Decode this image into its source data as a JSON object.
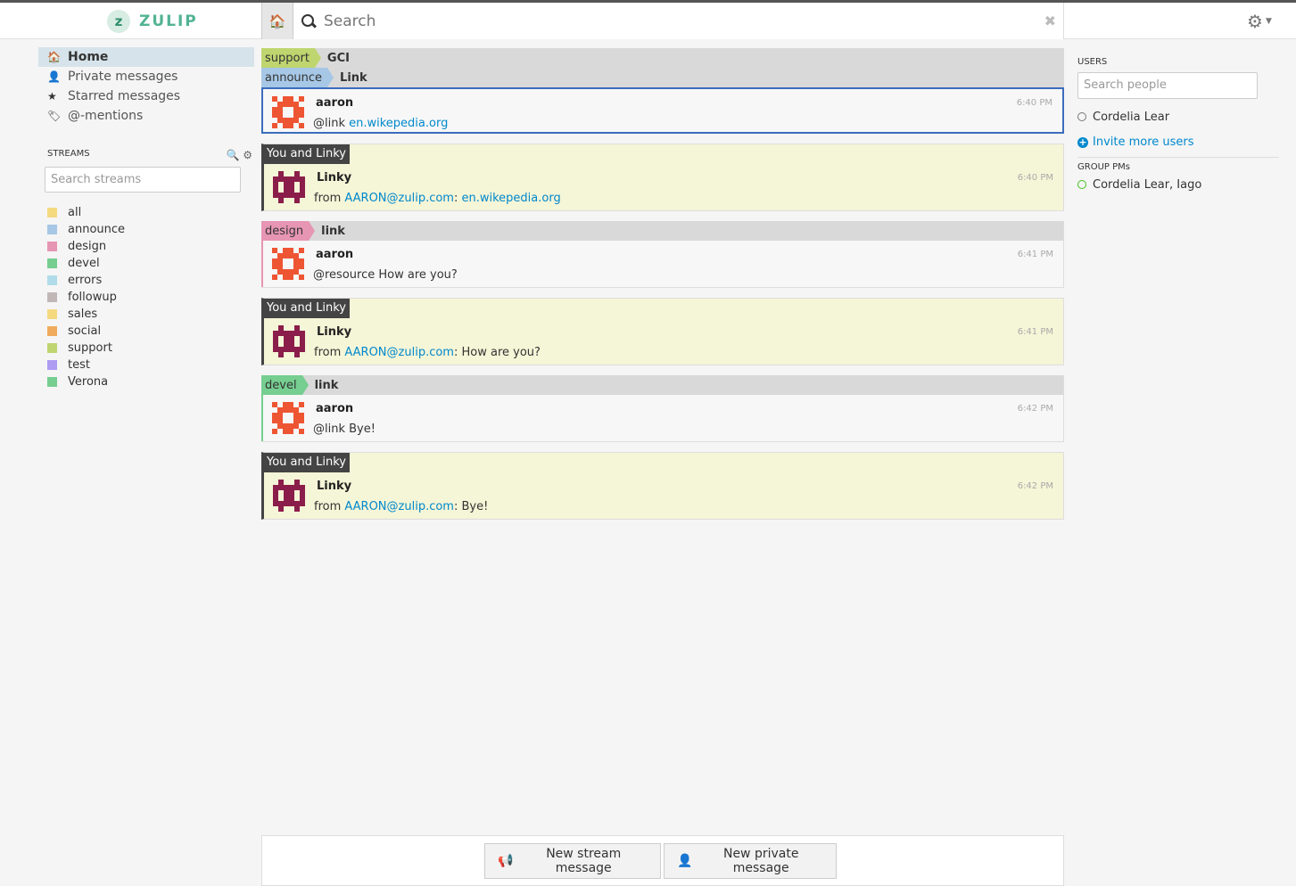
{
  "app": {
    "name": "ZULIP",
    "logo_letter": "z",
    "brand_color": "#52b394"
  },
  "header": {
    "search_placeholder": "Search",
    "clear_symbol": "✖",
    "home_icon": "home-icon",
    "settings_icon": "gear-icon"
  },
  "nav": [
    {
      "label": "Home",
      "icon": "home-icon",
      "glyph": "🏠",
      "active": true
    },
    {
      "label": "Private messages",
      "icon": "user-icon",
      "glyph": "👤"
    },
    {
      "label": "Starred messages",
      "icon": "star-icon",
      "glyph": "★"
    },
    {
      "label": "@-mentions",
      "icon": "tag-icon",
      "glyph": "🏷"
    }
  ],
  "streams": {
    "heading": "STREAMS",
    "search_placeholder": "Search streams",
    "items": [
      {
        "name": "all",
        "color": "#f4d97f"
      },
      {
        "name": "announce",
        "color": "#a6c7e5"
      },
      {
        "name": "design",
        "color": "#e695b2"
      },
      {
        "name": "devel",
        "color": "#76ce90"
      },
      {
        "name": "errors",
        "color": "#b0dbe8"
      },
      {
        "name": "followup",
        "color": "#c2b7b7"
      },
      {
        "name": "sales",
        "color": "#f4d97f"
      },
      {
        "name": "social",
        "color": "#f0ab5c"
      },
      {
        "name": "support",
        "color": "#bfd56f"
      },
      {
        "name": "test",
        "color": "#ae9bf2"
      },
      {
        "name": "Verona",
        "color": "#76ce90"
      }
    ]
  },
  "messages": {
    "m1": {
      "stream1": "support",
      "stream1_color": "#bfd56f",
      "topic1": "GCI",
      "stream2": "announce",
      "stream2_color": "#a6c7e5",
      "topic2": "Link",
      "sender": "aaron",
      "time": "6:40 PM",
      "prefix": "@link ",
      "link": "en.wikepedia.org"
    },
    "m2": {
      "label": "You and Linky",
      "sender": "Linky",
      "time": "6:40 PM",
      "prefix": "from ",
      "email": "AARON@zulip.com",
      "sep": ": ",
      "link": "en.wikepedia.org"
    },
    "m3": {
      "stream": "design",
      "stream_color": "#e695b2",
      "topic": "link",
      "sender": "aaron",
      "time": "6:41 PM",
      "text": "@resource How are you?"
    },
    "m4": {
      "label": "You and Linky",
      "sender": "Linky",
      "time": "6:41 PM",
      "prefix": "from ",
      "email": "AARON@zulip.com",
      "text": ": How are you?"
    },
    "m5": {
      "stream": "devel",
      "stream_color": "#76ce90",
      "topic": "link",
      "sender": "aaron",
      "time": "6:42 PM",
      "text": "@link Bye!"
    },
    "m6": {
      "label": "You and Linky",
      "sender": "Linky",
      "time": "6:42 PM",
      "prefix": "from ",
      "email": "AARON@zulip.com",
      "text": ": Bye!"
    }
  },
  "compose": {
    "stream_button": "New stream message",
    "private_button": "New private message"
  },
  "users": {
    "heading": "USERS",
    "search_placeholder": "Search people",
    "list": [
      {
        "name": "Cordelia Lear",
        "status": "offline"
      }
    ],
    "invite": "Invite more users",
    "group_heading": "GROUP PMs",
    "groups": [
      {
        "name": "Cordelia Lear, Iago",
        "status": "active"
      }
    ]
  }
}
